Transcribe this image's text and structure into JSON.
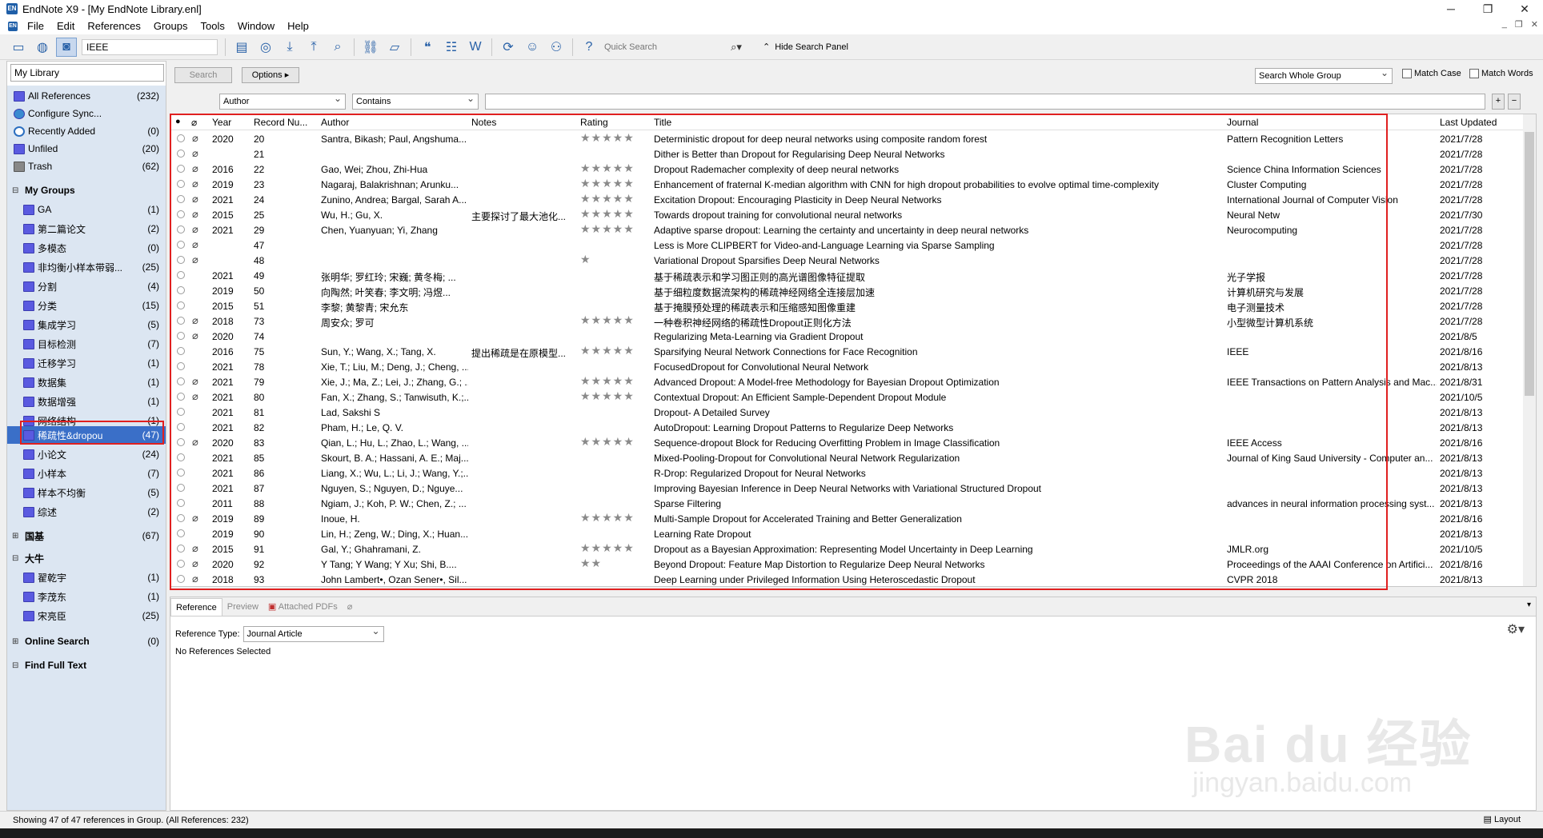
{
  "window": {
    "title": "EndNote X9 - [My EndNote Library.enl]",
    "app_icon": "EN"
  },
  "menu": [
    "File",
    "Edit",
    "References",
    "Groups",
    "Tools",
    "Window",
    "Help"
  ],
  "toolbar": {
    "style": "IEEE",
    "quick_search_placeholder": "Quick Search",
    "hide_search_panel": "Hide Search Panel"
  },
  "sidebar": {
    "library_selector": "My Library",
    "items": [
      {
        "label": "All References",
        "count": "(232)"
      },
      {
        "label": "Configure Sync...",
        "count": ""
      },
      {
        "label": "Recently Added",
        "count": "(0)"
      },
      {
        "label": "Unfiled",
        "count": "(20)"
      },
      {
        "label": "Trash",
        "count": "(62)"
      }
    ],
    "my_groups_header": "My Groups",
    "groups": [
      {
        "label": "GA",
        "count": "(1)"
      },
      {
        "label": "第二篇论文",
        "count": "(2)"
      },
      {
        "label": "多模态",
        "count": "(0)"
      },
      {
        "label": "非均衡小样本带弱...",
        "count": "(25)"
      },
      {
        "label": "分割",
        "count": "(4)"
      },
      {
        "label": "分类",
        "count": "(15)"
      },
      {
        "label": "集成学习",
        "count": "(5)"
      },
      {
        "label": "目标检测",
        "count": "(7)"
      },
      {
        "label": "迁移学习",
        "count": "(1)"
      },
      {
        "label": "数据集",
        "count": "(1)"
      },
      {
        "label": "数据增强",
        "count": "(1)"
      },
      {
        "label": "网络结构",
        "count": "(1)"
      },
      {
        "label": "稀疏性&dropou",
        "count": "(47)"
      },
      {
        "label": "小论文",
        "count": "(24)"
      },
      {
        "label": "小样本",
        "count": "(7)"
      },
      {
        "label": "样本不均衡",
        "count": "(5)"
      },
      {
        "label": "综述",
        "count": "(2)"
      }
    ],
    "guoji": {
      "label": "国基",
      "count": "(67)"
    },
    "daniu": {
      "label": "大牛"
    },
    "daniu_groups": [
      {
        "label": "翟乾宇",
        "count": "(1)"
      },
      {
        "label": "李茂东",
        "count": "(1)"
      },
      {
        "label": "宋亮臣",
        "count": "(25)"
      }
    ],
    "online_search": {
      "label": "Online Search",
      "count": "(0)"
    },
    "find_full_text": {
      "label": "Find Full Text"
    }
  },
  "search_panel": {
    "search_button": "Search",
    "options_button": "Options ▸",
    "scope": "Search Whole Group",
    "match_case": "Match Case",
    "match_words": "Match Words",
    "field": "Author",
    "operator": "Contains"
  },
  "table": {
    "columns": [
      "Year",
      "Record Nu...",
      "Author",
      "Notes",
      "Rating",
      "Title",
      "Journal",
      "Last Updated"
    ],
    "rows": [
      {
        "clip": true,
        "year": "2020",
        "rec": "20",
        "author": "Santra, Bikash; Paul, Angshuma...",
        "notes": "",
        "rating": 5,
        "title": "Deterministic dropout for deep neural networks using composite random forest",
        "journal": "Pattern Recognition Letters",
        "updated": "2021/7/28"
      },
      {
        "clip": true,
        "year": "",
        "rec": "21",
        "author": "",
        "notes": "",
        "rating": 0,
        "title": "Dither is Better than Dropout for Regularising Deep Neural Networks",
        "journal": "",
        "updated": "2021/7/28"
      },
      {
        "clip": true,
        "year": "2016",
        "rec": "22",
        "author": "Gao, Wei; Zhou, Zhi-Hua",
        "notes": "",
        "rating": 5,
        "title": "Dropout Rademacher complexity of deep neural networks",
        "journal": "Science China Information Sciences",
        "updated": "2021/7/28"
      },
      {
        "clip": true,
        "year": "2019",
        "rec": "23",
        "author": "Nagaraj, Balakrishnan; Arunku...",
        "notes": "",
        "rating": 5,
        "title": "Enhancement of fraternal K-median algorithm with CNN for high dropout probabilities to evolve optimal time-complexity",
        "journal": "Cluster Computing",
        "updated": "2021/7/28"
      },
      {
        "clip": true,
        "year": "2021",
        "rec": "24",
        "author": "Zunino, Andrea; Bargal, Sarah A...",
        "notes": "",
        "rating": 5,
        "title": "Excitation Dropout: Encouraging Plasticity in Deep Neural Networks",
        "journal": "International Journal of Computer Vision",
        "updated": "2021/7/28"
      },
      {
        "clip": true,
        "year": "2015",
        "rec": "25",
        "author": "Wu, H.; Gu, X.",
        "notes": "主要探讨了最大池化...",
        "rating": 5,
        "title": "Towards dropout training for convolutional neural networks",
        "journal": "Neural Netw",
        "updated": "2021/7/30"
      },
      {
        "clip": true,
        "year": "2021",
        "rec": "29",
        "author": "Chen, Yuanyuan; Yi, Zhang",
        "notes": "",
        "rating": 5,
        "title": "Adaptive sparse dropout: Learning the certainty and uncertainty in deep neural networks",
        "journal": "Neurocomputing",
        "updated": "2021/7/28"
      },
      {
        "clip": true,
        "year": "",
        "rec": "47",
        "author": "",
        "notes": "",
        "rating": 0,
        "title": "Less is More CLIPBERT for Video-and-Language Learning via Sparse Sampling",
        "journal": "",
        "updated": "2021/7/28"
      },
      {
        "clip": true,
        "year": "",
        "rec": "48",
        "author": "",
        "notes": "",
        "rating": 1,
        "title": "Variational Dropout Sparsifies Deep Neural Networks",
        "journal": "",
        "updated": "2021/7/28"
      },
      {
        "clip": false,
        "year": "2021",
        "rec": "49",
        "author": "张明华; 罗红玲; 宋巍; 黄冬梅; ...",
        "notes": "",
        "rating": 0,
        "title": "基于稀疏表示和学习图正则的高光谱图像特征提取",
        "journal": "光子学报",
        "updated": "2021/7/28"
      },
      {
        "clip": false,
        "year": "2019",
        "rec": "50",
        "author": "向陶然; 叶笑春; 李文明; 冯煜...",
        "notes": "",
        "rating": 0,
        "title": "基于细粒度数据流架构的稀疏神经网络全连接层加速",
        "journal": "计算机研究与发展",
        "updated": "2021/7/28"
      },
      {
        "clip": false,
        "year": "2015",
        "rec": "51",
        "author": "李黎; 黄黎青; 宋允东",
        "notes": "",
        "rating": 0,
        "title": "基于掩膜预处理的稀疏表示和压缩感知图像重建",
        "journal": "电子测量技术",
        "updated": "2021/7/28"
      },
      {
        "clip": true,
        "year": "2018",
        "rec": "73",
        "author": "周安众; 罗可",
        "notes": "",
        "rating": 5,
        "title": "一种卷积神经网络的稀疏性Dropout正则化方法",
        "journal": "小型微型计算机系统",
        "updated": "2021/7/28"
      },
      {
        "clip": true,
        "year": "2020",
        "rec": "74",
        "author": "",
        "notes": "",
        "rating": 0,
        "title": "Regularizing Meta-Learning via Gradient Dropout",
        "journal": "",
        "updated": "2021/8/5"
      },
      {
        "clip": false,
        "year": "2016",
        "rec": "75",
        "author": "Sun, Y.; Wang, X.; Tang, X.",
        "notes": "提出稀疏是在原模型...",
        "rating": 5,
        "title": "Sparsifying Neural Network Connections for Face Recognition",
        "journal": "IEEE",
        "updated": "2021/8/16"
      },
      {
        "clip": false,
        "year": "2021",
        "rec": "78",
        "author": "Xie, T.; Liu, M.; Deng, J.; Cheng, ...",
        "notes": "",
        "rating": 0,
        "title": "FocusedDropout for Convolutional Neural Network",
        "journal": "",
        "updated": "2021/8/13"
      },
      {
        "clip": true,
        "year": "2021",
        "rec": "79",
        "author": "Xie, J.; Ma, Z.; Lei, J.; Zhang, G.; ...",
        "notes": "",
        "rating": 5,
        "title": "Advanced Dropout: A Model-free Methodology for Bayesian Dropout Optimization",
        "journal": "IEEE Transactions on Pattern Analysis and Mac...",
        "updated": "2021/8/31"
      },
      {
        "clip": true,
        "year": "2021",
        "rec": "80",
        "author": "Fan, X.; Zhang, S.; Tanwisuth, K.;...",
        "notes": "",
        "rating": 5,
        "title": "Contextual Dropout: An Efficient Sample-Dependent Dropout Module",
        "journal": "",
        "updated": "2021/10/5"
      },
      {
        "clip": false,
        "year": "2021",
        "rec": "81",
        "author": "Lad, Sakshi S",
        "notes": "",
        "rating": 0,
        "title": "Dropout- A Detailed Survey",
        "journal": "",
        "updated": "2021/8/13"
      },
      {
        "clip": false,
        "year": "2021",
        "rec": "82",
        "author": "Pham, H.; Le, Q. V.",
        "notes": "",
        "rating": 0,
        "title": "AutoDropout: Learning Dropout Patterns to Regularize Deep Networks",
        "journal": "",
        "updated": "2021/8/13"
      },
      {
        "clip": true,
        "year": "2020",
        "rec": "83",
        "author": "Qian, L.; Hu, L.; Zhao, L.; Wang, ...",
        "notes": "",
        "rating": 5,
        "title": "Sequence-dropout Block for Reducing Overfitting Problem in Image Classification",
        "journal": "IEEE Access",
        "updated": "2021/8/16"
      },
      {
        "clip": false,
        "year": "2021",
        "rec": "85",
        "author": "Skourt, B. A.; Hassani, A. E.; Maj...",
        "notes": "",
        "rating": 0,
        "title": "Mixed-Pooling-Dropout for Convolutional Neural Network Regularization",
        "journal": "Journal of King Saud University - Computer an...",
        "updated": "2021/8/13"
      },
      {
        "clip": false,
        "year": "2021",
        "rec": "86",
        "author": "Liang, X.; Wu, L.; Li, J.; Wang, Y.;...",
        "notes": "",
        "rating": 0,
        "title": "R-Drop: Regularized Dropout for Neural Networks",
        "journal": "",
        "updated": "2021/8/13"
      },
      {
        "clip": false,
        "year": "2021",
        "rec": "87",
        "author": "Nguyen, S.; Nguyen, D.; Nguye...",
        "notes": "",
        "rating": 0,
        "title": "Improving Bayesian Inference in Deep Neural Networks with Variational Structured Dropout",
        "journal": "",
        "updated": "2021/8/13"
      },
      {
        "clip": false,
        "year": "2011",
        "rec": "88",
        "author": "Ngiam, J.; Koh, P. W.; Chen, Z.; ...",
        "notes": "",
        "rating": 0,
        "title": "Sparse Filtering",
        "journal": "advances in neural information processing syst...",
        "updated": "2021/8/13"
      },
      {
        "clip": true,
        "year": "2019",
        "rec": "89",
        "author": "Inoue, H.",
        "notes": "",
        "rating": 5,
        "title": "Multi-Sample Dropout for Accelerated Training and Better Generalization",
        "journal": "",
        "updated": "2021/8/16"
      },
      {
        "clip": false,
        "year": "2019",
        "rec": "90",
        "author": "Lin, H.; Zeng, W.; Ding, X.; Huan...",
        "notes": "",
        "rating": 0,
        "title": "Learning Rate Dropout",
        "journal": "",
        "updated": "2021/8/13"
      },
      {
        "clip": true,
        "year": "2015",
        "rec": "91",
        "author": "Gal, Y.; Ghahramani, Z.",
        "notes": "",
        "rating": 5,
        "title": "Dropout as a Bayesian Approximation: Representing Model Uncertainty in Deep Learning",
        "journal": "JMLR.org",
        "updated": "2021/10/5"
      },
      {
        "clip": true,
        "year": "2020",
        "rec": "92",
        "author": "Y Tang; Y Wang; Y Xu; Shi, B....",
        "notes": "",
        "rating": 2,
        "title": "Beyond Dropout: Feature Map Distortion to Regularize Deep Neural Networks",
        "journal": "Proceedings of the AAAI Conference on Artifici...",
        "updated": "2021/8/16"
      },
      {
        "clip": true,
        "year": "2018",
        "rec": "93",
        "author": "John Lambert•, Ozan Sener•, Sil...",
        "notes": "",
        "rating": 0,
        "title": "Deep Learning under Privileged Information Using Heteroscedastic Dropout",
        "journal": "CVPR 2018",
        "updated": "2021/8/13"
      }
    ]
  },
  "bottom_panel": {
    "tabs": [
      "Reference",
      "Preview",
      "Attached PDFs"
    ],
    "ref_type_label": "Reference Type:",
    "ref_type_value": "Journal Article",
    "no_refs": "No References Selected"
  },
  "status": {
    "text": "Showing 47 of 47 references in Group. (All References: 232)",
    "layout": "Layout"
  },
  "watermark": {
    "main": "Bai du 经验",
    "sub": "jingyan.baidu.com"
  },
  "colors": {
    "selected": "#3a6fc8",
    "sidebar_bg": "#dce6f2",
    "highlight": "#e02020",
    "star": "#8a8a8a"
  }
}
